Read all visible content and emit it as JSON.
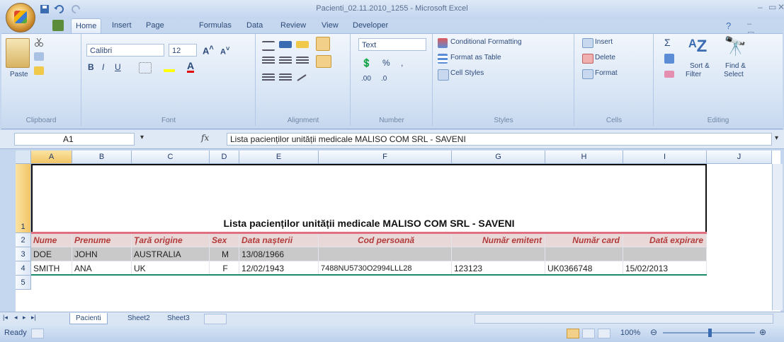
{
  "window": {
    "title": "Pacienti_02.11.2010_1255 - Microsoft Excel"
  },
  "ribbon": {
    "tabs": [
      {
        "label": "Home",
        "active": true
      },
      {
        "label": "Insert",
        "active": false
      },
      {
        "label": "Page Layout",
        "active": false
      },
      {
        "label": "Formulas",
        "active": false
      },
      {
        "label": "Data",
        "active": false
      },
      {
        "label": "Review",
        "active": false
      },
      {
        "label": "View",
        "active": false
      },
      {
        "label": "Developer",
        "active": false
      }
    ],
    "clipboard": {
      "paste": "Paste",
      "label": "Clipboard"
    },
    "font": {
      "name": "Calibri",
      "size": "12",
      "label": "Font"
    },
    "alignment": {
      "label": "Alignment"
    },
    "number": {
      "format": "Text",
      "label": "Number"
    },
    "styles": {
      "conditional": "Conditional Formatting",
      "format_table": "Format as Table",
      "cell_styles": "Cell Styles",
      "label": "Styles"
    },
    "cells": {
      "insert": "Insert",
      "delete": "Delete",
      "format": "Format",
      "label": "Cells"
    },
    "editing": {
      "sort": "Sort &",
      "filter": "Filter",
      "find": "Find &",
      "select": "Select",
      "label": "Editing"
    }
  },
  "formula_bar": {
    "cell_ref": "A1",
    "fx": "fx",
    "content": "Lista pacienților unității medicale MALISO COM SRL - SAVENI"
  },
  "grid": {
    "columns": [
      "A",
      "B",
      "C",
      "D",
      "E",
      "F",
      "G",
      "H",
      "I",
      "J"
    ],
    "rows": [
      "1",
      "2",
      "3",
      "4",
      "5"
    ],
    "title": "Lista pacienților unității medicale MALISO COM SRL - SAVENI",
    "headers": [
      "Nume",
      "Prenume",
      "Țară origine",
      "Sex",
      "Data nașterii",
      "Cod persoană",
      "Număr emitent",
      "Număr card",
      "Dată expirare"
    ],
    "data": [
      [
        "DOE",
        "JOHN",
        "AUSTRALIA",
        "M",
        "13/08/1966",
        "",
        "",
        "",
        ""
      ],
      [
        "SMITH",
        "ANA",
        "UK",
        "F",
        "12/02/1943",
        "7488NU5730O2994LLL28",
        "123123",
        "UK0366748",
        "15/02/2013"
      ]
    ]
  },
  "sheets": {
    "tabs": [
      "Pacienti",
      "Sheet2",
      "Sheet3"
    ]
  },
  "status": {
    "ready": "Ready",
    "zoom": "100%"
  }
}
